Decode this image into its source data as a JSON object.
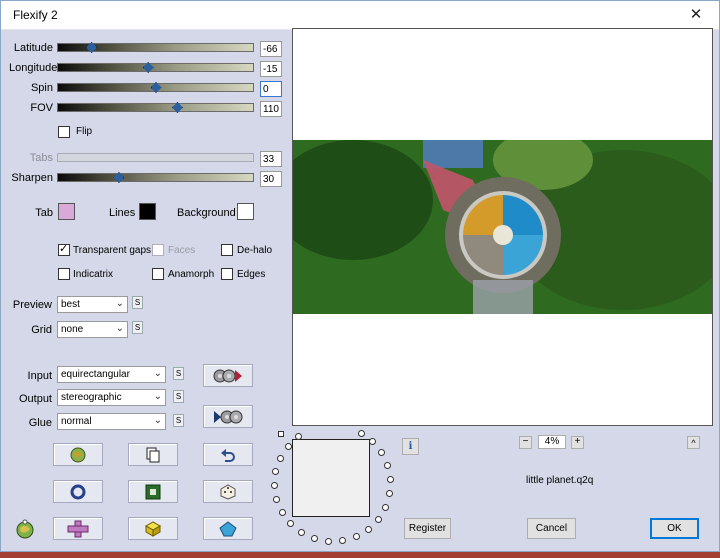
{
  "window": {
    "title": "Flexify 2",
    "close": "✕"
  },
  "sliders": [
    {
      "label": "Latitude",
      "value": "-66",
      "level": 0.17,
      "disabled": false
    },
    {
      "label": "Longitude",
      "value": "-15",
      "level": 0.46,
      "disabled": false
    },
    {
      "label": "Spin",
      "value": "0",
      "level": 0.5,
      "disabled": false
    },
    {
      "label": "FOV",
      "value": "110",
      "level": 0.61,
      "disabled": false
    }
  ],
  "flip": {
    "label": "Flip",
    "checked": false
  },
  "tabs": {
    "label": "Tabs",
    "value": "33",
    "disabled": true
  },
  "sharpen": {
    "label": "Sharpen",
    "value": "30",
    "level": 0.31
  },
  "colors": {
    "tab": {
      "label": "Tab",
      "color": "#d9a9d9"
    },
    "lines": {
      "label": "Lines",
      "color": "#000000"
    },
    "background": {
      "label": "Background",
      "color": "#ffffff"
    }
  },
  "checks": {
    "transparent_gaps": {
      "label": "Transparent gaps",
      "checked": true
    },
    "faces": {
      "label": "Faces",
      "checked": false,
      "disabled": true
    },
    "de_halo": {
      "label": "De-halo",
      "checked": false
    },
    "indicatrix": {
      "label": "Indicatrix",
      "checked": false
    },
    "anamorph": {
      "label": "Anamorph",
      "checked": false
    },
    "edges": {
      "label": "Edges",
      "checked": false
    }
  },
  "preview": {
    "label": "Preview",
    "value": "best"
  },
  "grid": {
    "label": "Grid",
    "value": "none"
  },
  "input": {
    "label": "Input",
    "value": "equirectangular"
  },
  "output": {
    "label": "Output",
    "value": "stereographic"
  },
  "glue": {
    "label": "Glue",
    "value": "normal"
  },
  "s_label": "S",
  "zoom": {
    "minus": "−",
    "value": "4%",
    "plus": "+"
  },
  "collapse_label": "^",
  "info_label": "i",
  "preset_name": "little planet.q2q",
  "buttons": {
    "register": "Register",
    "cancel": "Cancel",
    "ok": "OK"
  }
}
